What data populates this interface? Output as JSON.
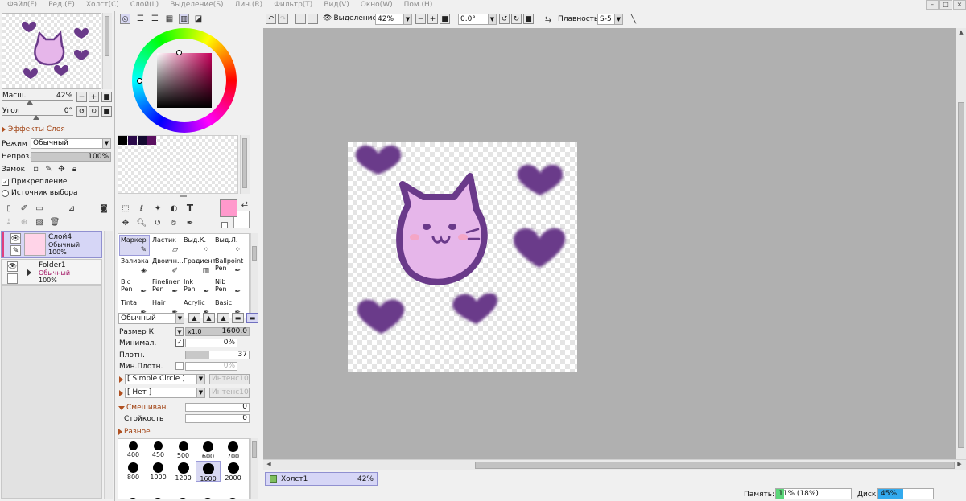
{
  "menu": [
    "Файл(F)",
    "Ред.(E)",
    "Холст(C)",
    "Слой(L)",
    "Выделение(S)",
    "Лин.(R)",
    "Фильтр(T)",
    "Вид(V)",
    "Окно(W)",
    "Пом.(H)"
  ],
  "navigator": {
    "zoom_label": "Масш.",
    "zoom_value": "42%",
    "angle_label": "Угол",
    "angle_value": "0°"
  },
  "layer_panel": {
    "effects_label": "Эффекты Слоя",
    "mode_label": "Режим",
    "mode_value": "Обычный",
    "opacity_label": "Непроз.",
    "opacity_value": "100%",
    "lock_label": "Замок",
    "clipping_label": "Прикрепление",
    "selection_source_label": "Источник выбора",
    "layers": [
      {
        "name": "Слой4",
        "mode": "Обычный",
        "opacity": "100%"
      },
      {
        "name": "Folder1",
        "mode": "Обычный",
        "opacity": "100%"
      }
    ]
  },
  "color": {
    "current": "#ff99cc",
    "secondary": "#ffffff",
    "swatches": [
      "#000000",
      "#2a0a4a",
      "#140a30",
      "#5a1060"
    ]
  },
  "tools": [
    {
      "name": "Маркер",
      "sub": "",
      "selected": true
    },
    {
      "name": "Ластик",
      "sub": ""
    },
    {
      "name": "Выд.К.",
      "sub": ""
    },
    {
      "name": "Выд.Л.",
      "sub": ""
    },
    {
      "name": "Заливка",
      "sub": ""
    },
    {
      "name": "Двоичн...",
      "sub": ""
    },
    {
      "name": "Градиент",
      "sub": ""
    },
    {
      "name": "Ballpoint",
      "sub": "Pen"
    },
    {
      "name": "Bic",
      "sub": "Pen"
    },
    {
      "name": "Fineliner",
      "sub": "Pen"
    },
    {
      "name": "Ink",
      "sub": "Pen"
    },
    {
      "name": "Nib",
      "sub": "Pen"
    },
    {
      "name": "Tinta",
      "sub": ""
    },
    {
      "name": "Hair",
      "sub": ""
    },
    {
      "name": "Acrylic",
      "sub": ""
    },
    {
      "name": "Basic",
      "sub": ""
    }
  ],
  "brush": {
    "blend_mode": "Обычный",
    "size_label": "Размер К.",
    "size_mult": "x1.0",
    "size_value": "1600.0",
    "min_label": "Минимал.",
    "min_value": "0%",
    "density_label": "Плотн.",
    "density_value": "37",
    "min_density_label": "Мин.Плотн.",
    "min_density_value": "0%",
    "shape": "[ Simple Circle ]",
    "shape_intensity": "Интенс100",
    "texture": "[ Нет ]",
    "texture_intensity": "Интенс100",
    "mixing_label": "Смешиван.",
    "mixing_value": "0",
    "persistence_label": "Стойкость",
    "persistence_value": "0",
    "misc_label": "Разное",
    "sizes": [
      "400",
      "450",
      "500",
      "600",
      "700",
      "800",
      "1000",
      "1200",
      "1600",
      "2000"
    ],
    "selected_size": "1600"
  },
  "toolbar": {
    "selection_label": "Выделение",
    "zoom": "42%",
    "angle": "0.0°",
    "smoothing_label": "Плавность",
    "smoothing_value": "S-5"
  },
  "canvas_tab": {
    "name": "Холст1",
    "zoom": "42%"
  },
  "status": {
    "memory_label": "Память:",
    "memory_value": "11% (18%)",
    "memory_fraction": 0.11,
    "disk_label": "Диск:",
    "disk_value": "45%",
    "disk_fraction": 0.45
  },
  "art_colors": {
    "dark": "#6a3a8a",
    "fill": "#e6b6ea",
    "blush": "#f4a6c6"
  }
}
